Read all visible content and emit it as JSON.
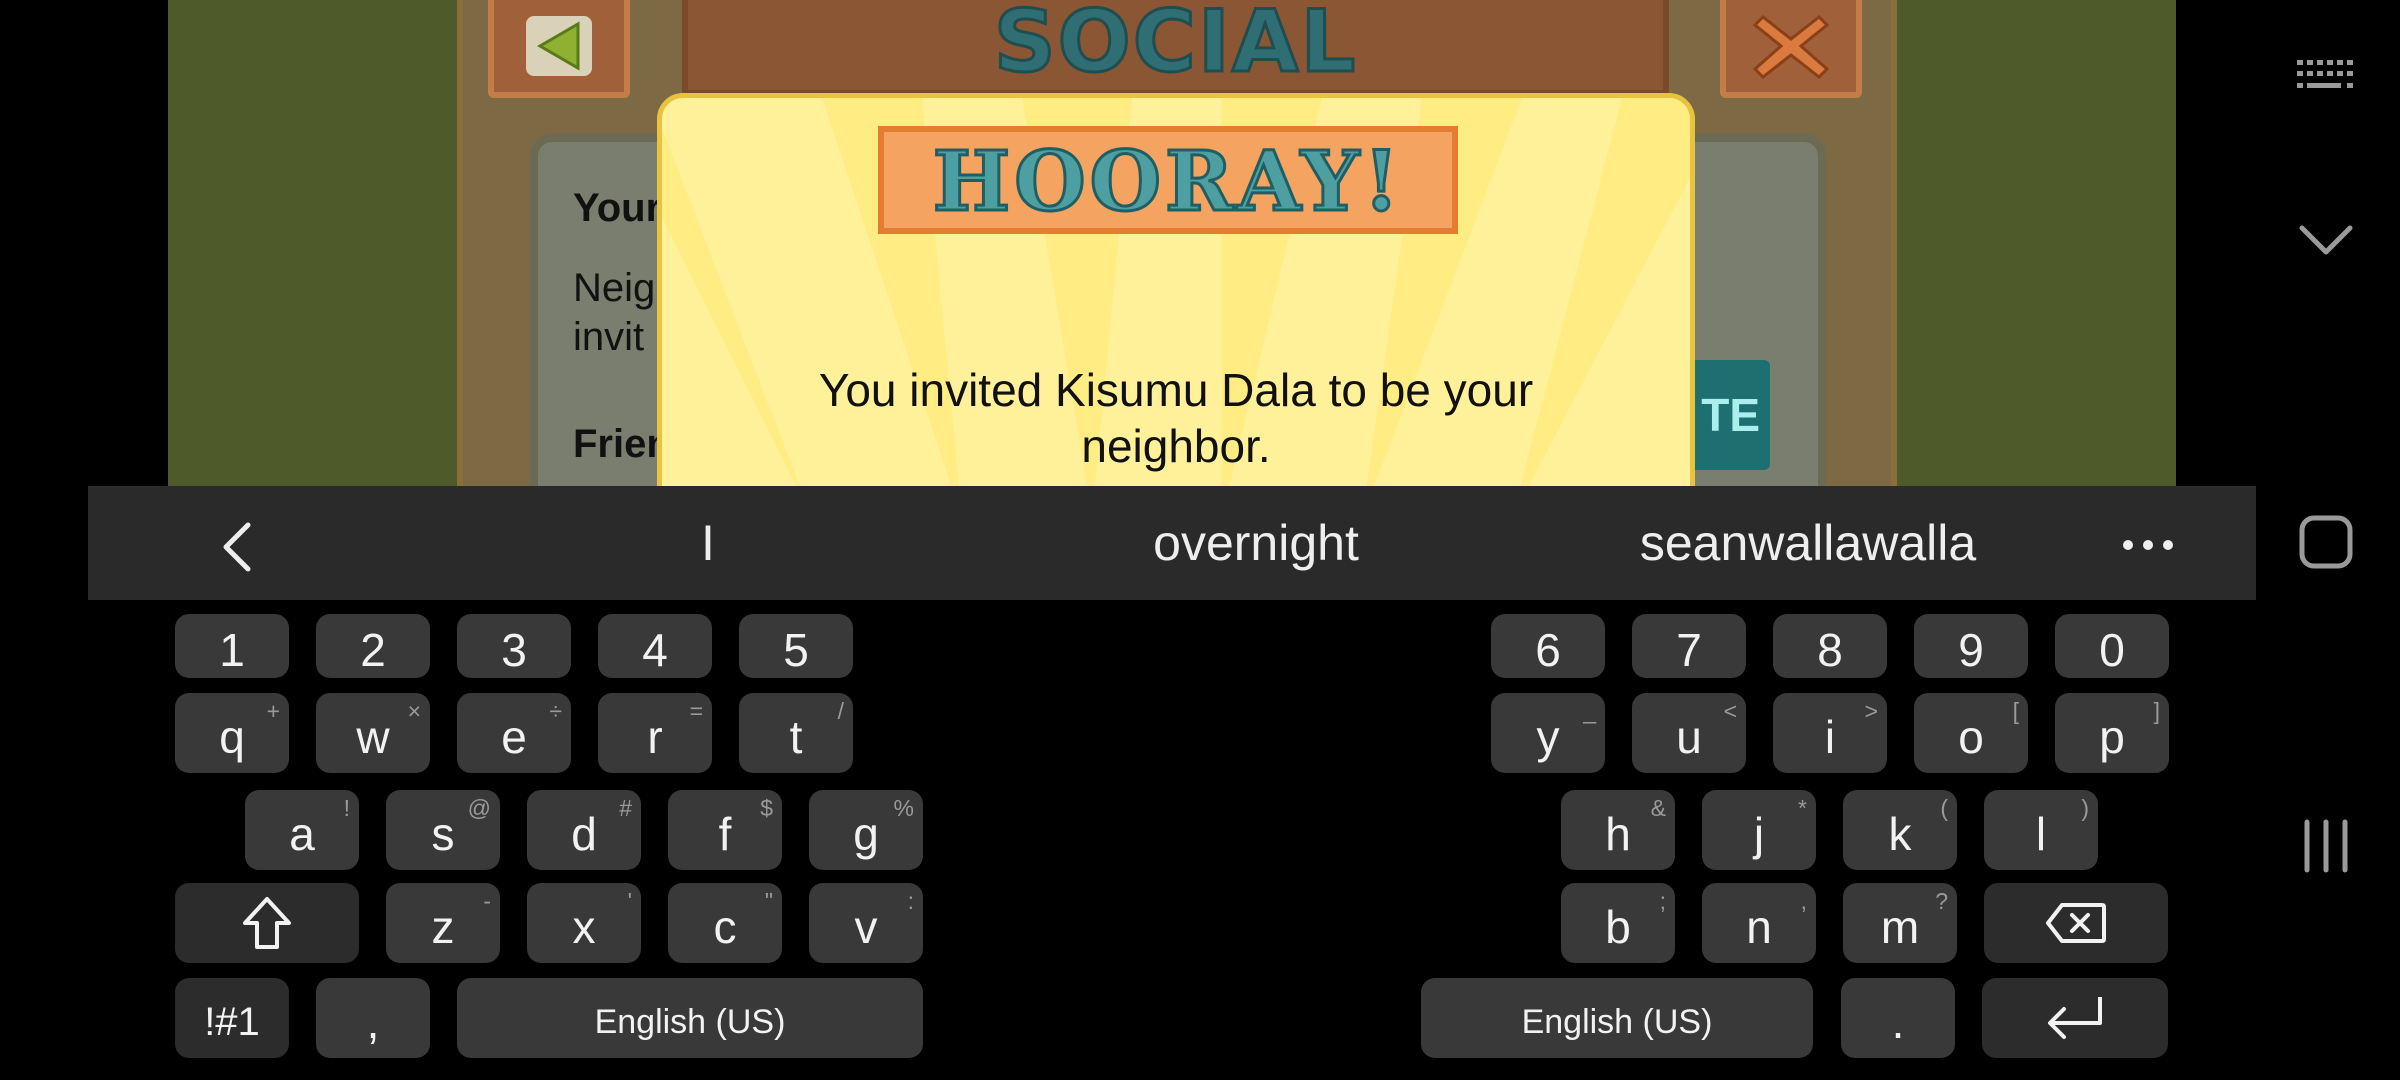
{
  "game": {
    "social_title": "SOCIAL",
    "partial_your": "Your",
    "partial_neighbors_line1": "Neig",
    "partial_neighbors_line2": "invit",
    "partial_friends": "Frien",
    "partial_invite_button": "TE"
  },
  "dialog": {
    "title": "HOORAY!",
    "message": "You invited Kisumu Dala to be your neighbor."
  },
  "suggestions": {
    "items": [
      "I",
      "overnight",
      "seanwallawalla"
    ]
  },
  "keyboard": {
    "numbers_left": [
      "1",
      "2",
      "3",
      "4",
      "5"
    ],
    "numbers_right": [
      "6",
      "7",
      "8",
      "9",
      "0"
    ],
    "row_q_left": [
      {
        "k": "q",
        "h": "+"
      },
      {
        "k": "w",
        "h": "×"
      },
      {
        "k": "e",
        "h": "÷"
      },
      {
        "k": "r",
        "h": "="
      },
      {
        "k": "t",
        "h": "/"
      }
    ],
    "row_q_right": [
      {
        "k": "y",
        "h": "_"
      },
      {
        "k": "u",
        "h": "<"
      },
      {
        "k": "i",
        "h": ">"
      },
      {
        "k": "o",
        "h": "["
      },
      {
        "k": "p",
        "h": "]"
      }
    ],
    "row_a_left": [
      {
        "k": "a",
        "h": "!"
      },
      {
        "k": "s",
        "h": "@"
      },
      {
        "k": "d",
        "h": "#"
      },
      {
        "k": "f",
        "h": "$"
      },
      {
        "k": "g",
        "h": "%"
      }
    ],
    "row_a_right": [
      {
        "k": "h",
        "h": "&"
      },
      {
        "k": "j",
        "h": "*"
      },
      {
        "k": "k",
        "h": "("
      },
      {
        "k": "l",
        "h": ")"
      }
    ],
    "row_z_left": [
      {
        "k": "z",
        "h": "-"
      },
      {
        "k": "x",
        "h": "'"
      },
      {
        "k": "c",
        "h": "\""
      },
      {
        "k": "v",
        "h": ":"
      }
    ],
    "row_z_right": [
      {
        "k": "b",
        "h": ";"
      },
      {
        "k": "n",
        "h": ","
      },
      {
        "k": "m",
        "h": "?"
      }
    ],
    "symbols_label": "!#1",
    "comma": ",",
    "space_left_label": "English (US)",
    "space_right_label": "English (US)",
    "period": "."
  }
}
